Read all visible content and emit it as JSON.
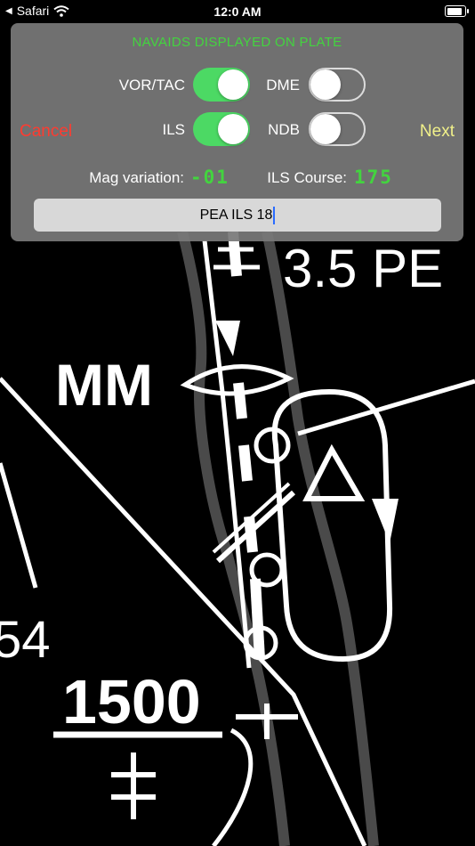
{
  "status_bar": {
    "carrier": "Safari",
    "time": "12:0 AM"
  },
  "dialog": {
    "title": "NAVAIDS DISPLAYED ON PLATE",
    "cancel_label": "Cancel",
    "next_label": "Next",
    "toggles": [
      {
        "label": "VOR/TAC",
        "on": true
      },
      {
        "label": "DME",
        "on": false
      },
      {
        "label": "ILS",
        "on": true
      },
      {
        "label": "NDB",
        "on": false
      }
    ],
    "mag_variation_label": "Mag variation:",
    "mag_variation_value": "-01",
    "ils_course_label": "ILS Course:",
    "ils_course_value": "175",
    "plate_name_value": "PEA ILS 18"
  },
  "plate": {
    "distance_label": "3.5 PE",
    "marker_label": "MM",
    "altitude_label": "1500",
    "partial_number": "54"
  },
  "colors": {
    "toggle_on": "#4cd964",
    "accent_green": "#43d43f",
    "cancel": "#ff3b30",
    "next": "#f0f08a"
  }
}
